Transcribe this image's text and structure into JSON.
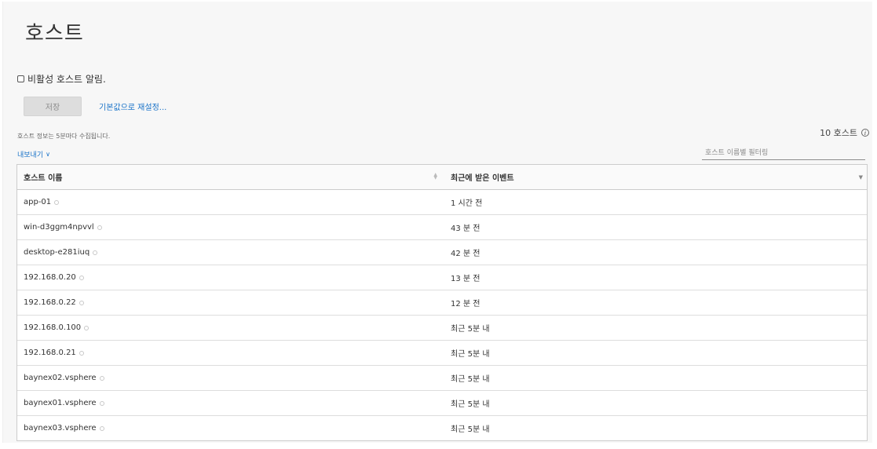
{
  "page": {
    "title": "호스트"
  },
  "settings": {
    "inactive_alert_label": "비활성 호스트 알림.",
    "inactive_alert_checked": false,
    "save_label": "저장",
    "reset_label": "기본값으로 재설정..."
  },
  "toolbar": {
    "info_text": "호스트 정보는 5분마다 수집됩니다.",
    "host_count": "10 호스트",
    "export_label": "내보내기",
    "filter_placeholder": "호스트 이름별 필터링"
  },
  "table": {
    "columns": [
      "호스트 이름",
      "최근에 받은 이벤트"
    ],
    "rows": [
      {
        "host": "app-01",
        "event": "1 시간 전"
      },
      {
        "host": "win-d3ggm4npvvl",
        "event": "43 분 전"
      },
      {
        "host": "desktop-e281iuq",
        "event": "42 분 전"
      },
      {
        "host": "192.168.0.20",
        "event": "13 분 전"
      },
      {
        "host": "192.168.0.22",
        "event": "12 분 전"
      },
      {
        "host": "192.168.0.100",
        "event": "최근 5분 내"
      },
      {
        "host": "192.168.0.21",
        "event": "최근 5분 내"
      },
      {
        "host": "baynex02.vsphere",
        "event": "최근 5분 내"
      },
      {
        "host": "baynex01.vsphere",
        "event": "최근 5분 내"
      },
      {
        "host": "baynex03.vsphere",
        "event": "최근 5분 내"
      }
    ]
  },
  "colors": {
    "link": "#1a73c8",
    "disabled_button": "#dddddd",
    "background": "#f7f7f7"
  }
}
